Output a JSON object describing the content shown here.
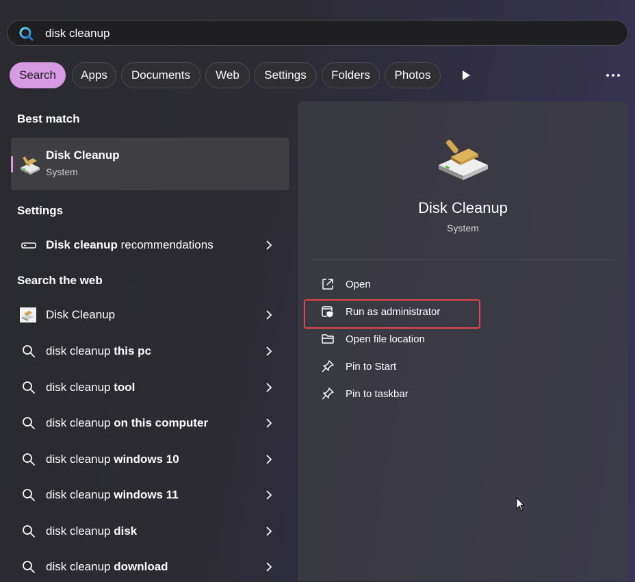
{
  "search": {
    "query": "disk cleanup"
  },
  "filters": {
    "chips": [
      "Search",
      "Apps",
      "Documents",
      "Web",
      "Settings",
      "Folders",
      "Photos"
    ],
    "active": "Search"
  },
  "left": {
    "best_match_heading": "Best match",
    "best_match": {
      "title": "Disk Cleanup",
      "subtitle": "System"
    },
    "settings_heading": "Settings",
    "settings_item": {
      "normal": "",
      "bold": "Disk cleanup",
      "suffix": " recommendations"
    },
    "web_heading": "Search the web",
    "web_items": [
      {
        "prefix": "Disk Cleanup",
        "bold": ""
      },
      {
        "prefix": "disk cleanup ",
        "bold": "this pc"
      },
      {
        "prefix": "disk cleanup ",
        "bold": "tool"
      },
      {
        "prefix": "disk cleanup ",
        "bold": "on this computer"
      },
      {
        "prefix": "disk cleanup ",
        "bold": "windows 10"
      },
      {
        "prefix": "disk cleanup ",
        "bold": "windows 11"
      },
      {
        "prefix": "disk cleanup ",
        "bold": "disk"
      },
      {
        "prefix": "disk cleanup ",
        "bold": "download"
      }
    ]
  },
  "detail": {
    "title": "Disk Cleanup",
    "subtitle": "System",
    "actions": [
      "Open",
      "Run as administrator",
      "Open file location",
      "Pin to Start",
      "Pin to taskbar"
    ],
    "highlighted_action": "Run as administrator"
  },
  "colors": {
    "accent": "#d79be3",
    "highlight_border": "#e2484b"
  },
  "icons": {
    "search": "search-icon",
    "play": "play-icon",
    "more": "more-icon",
    "disk_cleanup": "disk-cleanup-icon",
    "drive": "drive-icon",
    "chevron": "chevron-right-icon",
    "open": "open-external-icon",
    "run_admin": "shield-icon",
    "folder": "folder-icon",
    "pin": "pin-icon"
  }
}
